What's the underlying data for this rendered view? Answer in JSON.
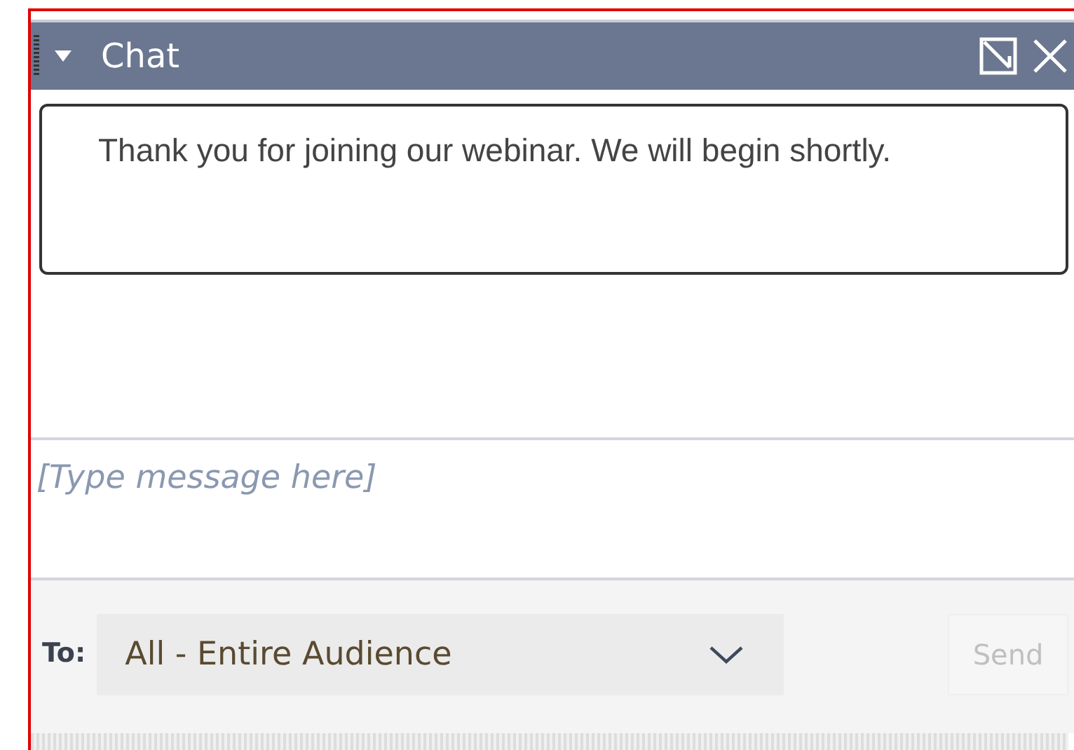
{
  "panel": {
    "title": "Chat",
    "expanded": true
  },
  "messages": [
    {
      "text": "Thank you for joining our webinar. We will begin shortly."
    }
  ],
  "composer": {
    "placeholder": "[Type message here]"
  },
  "recipient": {
    "label": "To:",
    "value": "All - Entire Audience"
  },
  "send_button": {
    "label": "Send",
    "disabled": true
  }
}
